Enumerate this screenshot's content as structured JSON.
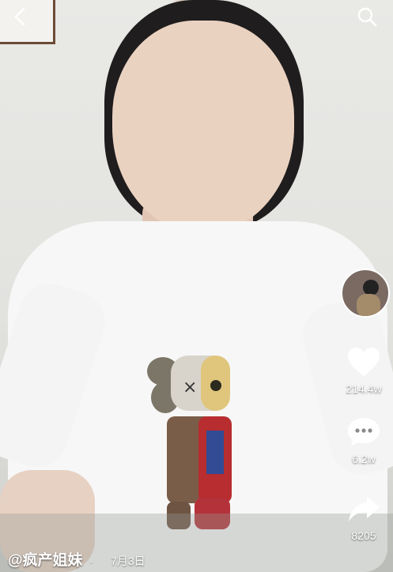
{
  "top_bar": {
    "back_icon": "chevron-left-icon",
    "search_icon": "search-icon"
  },
  "actions": {
    "avatar": "creator-avatar",
    "like": {
      "icon": "heart-icon",
      "count": "214.4w"
    },
    "comment": {
      "icon": "comment-bubble-icon",
      "count": "6.2w"
    },
    "share": {
      "icon": "share-arrow-icon",
      "count": "8205"
    }
  },
  "caption": {
    "author": "@疯产姐妹",
    "separator": "·",
    "date": "7月3日"
  },
  "colors": {
    "overlay_text": "#ffffff",
    "shirt": "#f7f7f7",
    "hair": "#1f1d1d",
    "skin": "#ead2c1"
  }
}
